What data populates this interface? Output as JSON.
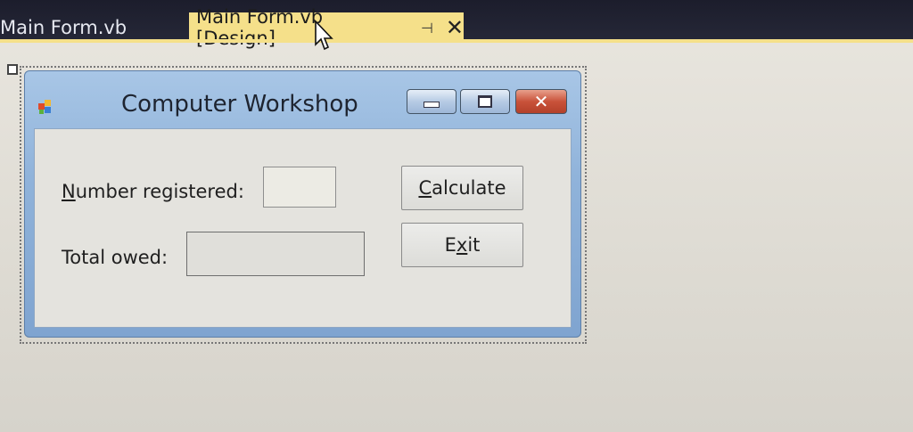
{
  "tabs": [
    {
      "label": "Main Form.vb",
      "active": false
    },
    {
      "label": "Main Form.vb [Design]",
      "active": true,
      "pin_icon": "pin-icon",
      "close_icon": "close-icon"
    }
  ],
  "form": {
    "title": "Computer Workshop",
    "icon": "form-app-icon",
    "controls": {
      "minimize": "minimize-icon",
      "maximize": "maximize-icon",
      "close": "close-icon"
    },
    "number_label": {
      "mnemonic": "N",
      "rest": "umber registered:"
    },
    "total_label": "Total owed:",
    "number_input_value": "",
    "total_value": "",
    "calculate_button": {
      "mnemonic": "C",
      "rest": "alculate"
    },
    "exit_button": {
      "before": "E",
      "mnemonic": "x",
      "after": "it"
    }
  },
  "colors": {
    "active_tab": "#f5e08a",
    "tabstrip": "#1c1d2c",
    "window_frame": "#90b3da",
    "close_button": "#c9523a"
  }
}
